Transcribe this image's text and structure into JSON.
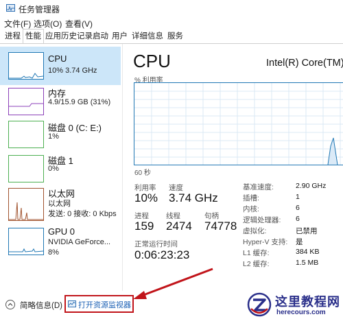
{
  "window": {
    "title": "任务管理器"
  },
  "menu": {
    "items": [
      "文件(F)",
      "选项(O)",
      "查看(V)"
    ]
  },
  "tabs": [
    "进程",
    "性能",
    "应用历史记录",
    "启动",
    "用户",
    "详细信息",
    "服务"
  ],
  "active_tab": "性能",
  "sidebar": {
    "items": [
      {
        "title": "CPU",
        "subtitle": "10% 3.74 GHz",
        "subtitle2": "",
        "color": "#1f77b4",
        "selected": true
      },
      {
        "title": "内存",
        "subtitle": "4.9/15.9 GB (31%)",
        "subtitle2": "",
        "color": "#8b3fb8",
        "selected": false
      },
      {
        "title": "磁盘 0 (C: E:)",
        "subtitle": "1%",
        "subtitle2": "",
        "color": "#4caf50",
        "selected": false
      },
      {
        "title": "磁盘 1",
        "subtitle": "0%",
        "subtitle2": "",
        "color": "#4caf50",
        "selected": false
      },
      {
        "title": "以太网",
        "subtitle": "以太网",
        "subtitle2": "发送: 0 接收: 0 Kbps",
        "color": "#a0522d",
        "selected": false
      },
      {
        "title": "GPU 0",
        "subtitle": "NVIDIA GeForce...",
        "subtitle2": "8%",
        "color": "#1f77b4",
        "selected": false
      }
    ]
  },
  "main": {
    "heading": "CPU",
    "model": "Intel(R) Core(TM) i",
    "util_label": "% 利用率",
    "seconds_label": "60 秒",
    "graph_color": "#1f77b4",
    "stats": {
      "utilization": {
        "label": "利用率",
        "value": "10%"
      },
      "speed": {
        "label": "速度",
        "value": "3.74 GHz"
      },
      "processes": {
        "label": "进程",
        "value": "159"
      },
      "threads": {
        "label": "线程",
        "value": "2474"
      },
      "handles": {
        "label": "句柄",
        "value": "74778"
      },
      "uptime": {
        "label": "正常运行时间",
        "value": "0:06:23:23"
      }
    },
    "specs": [
      {
        "label": "基准速度:",
        "value": "2.90 GHz"
      },
      {
        "label": "插槽:",
        "value": "1"
      },
      {
        "label": "内核:",
        "value": "6"
      },
      {
        "label": "逻辑处理器:",
        "value": "6"
      },
      {
        "label": "虚拟化:",
        "value": "已禁用"
      },
      {
        "label": "Hyper-V 支持:",
        "value": "是"
      },
      {
        "label": "L1 缓存:",
        "value": "384 KB"
      },
      {
        "label": "L2 缓存:",
        "value": "1.5 MB"
      }
    ]
  },
  "footer": {
    "summary_label": "简略信息(D)",
    "open_monitor_label": "打开资源监视器",
    "highlight_color": "#c1141a"
  },
  "watermark": {
    "name": "这里教程网",
    "url": "herecours.com"
  }
}
